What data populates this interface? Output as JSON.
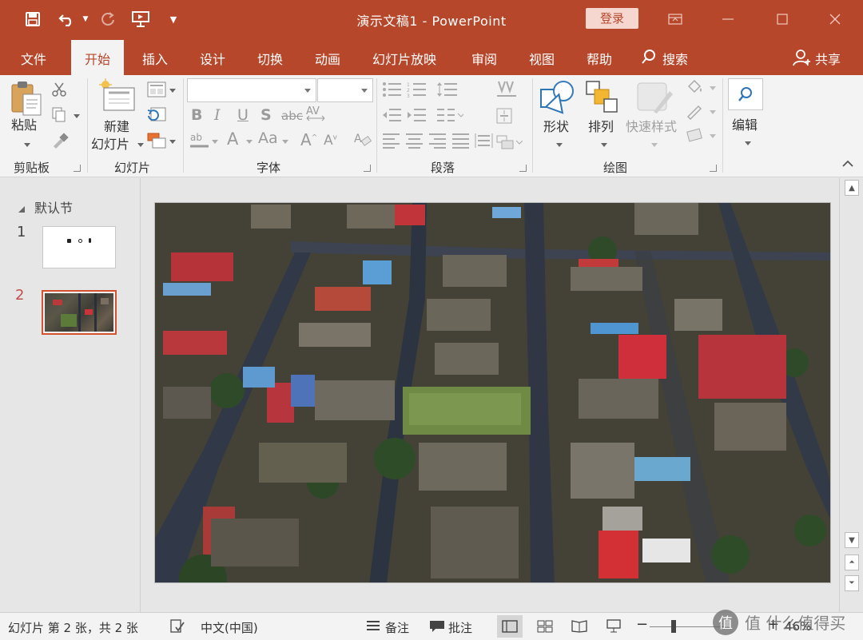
{
  "window": {
    "title": "演示文稿1  -  PowerPoint",
    "login_label": "登录"
  },
  "tabs": [
    {
      "label": "文件"
    },
    {
      "label": "开始"
    },
    {
      "label": "插入"
    },
    {
      "label": "设计"
    },
    {
      "label": "切换"
    },
    {
      "label": "动画"
    },
    {
      "label": "幻灯片放映"
    },
    {
      "label": "审阅"
    },
    {
      "label": "视图"
    },
    {
      "label": "帮助"
    },
    {
      "label": "搜索"
    }
  ],
  "share_label": "共享",
  "ribbon": {
    "paste_label": "粘贴",
    "new_slide_label_1": "新建",
    "new_slide_label_2": "幻灯片",
    "shapes_label": "形状",
    "arrange_label": "排列",
    "quick_styles_label": "快速样式",
    "edit_label": "编辑",
    "groups": {
      "clipboard": "剪贴板",
      "slides": "幻灯片",
      "font": "字体",
      "paragraph": "段落",
      "drawing": "绘图"
    }
  },
  "slides_pane": {
    "section_label": "默认节",
    "slide_numbers": [
      "1",
      "2"
    ]
  },
  "status": {
    "slide_info": "幻灯片 第 2 张，共 2 张",
    "language": "中文(中国)",
    "notes_label": "备注",
    "comments_label": "批注",
    "zoom": "46%"
  },
  "watermark": "值 什么值得买",
  "colors": {
    "accent": "#b7472a",
    "ribbon_bg": "#f3f3f3",
    "workspace_bg": "#e6e6e6"
  }
}
